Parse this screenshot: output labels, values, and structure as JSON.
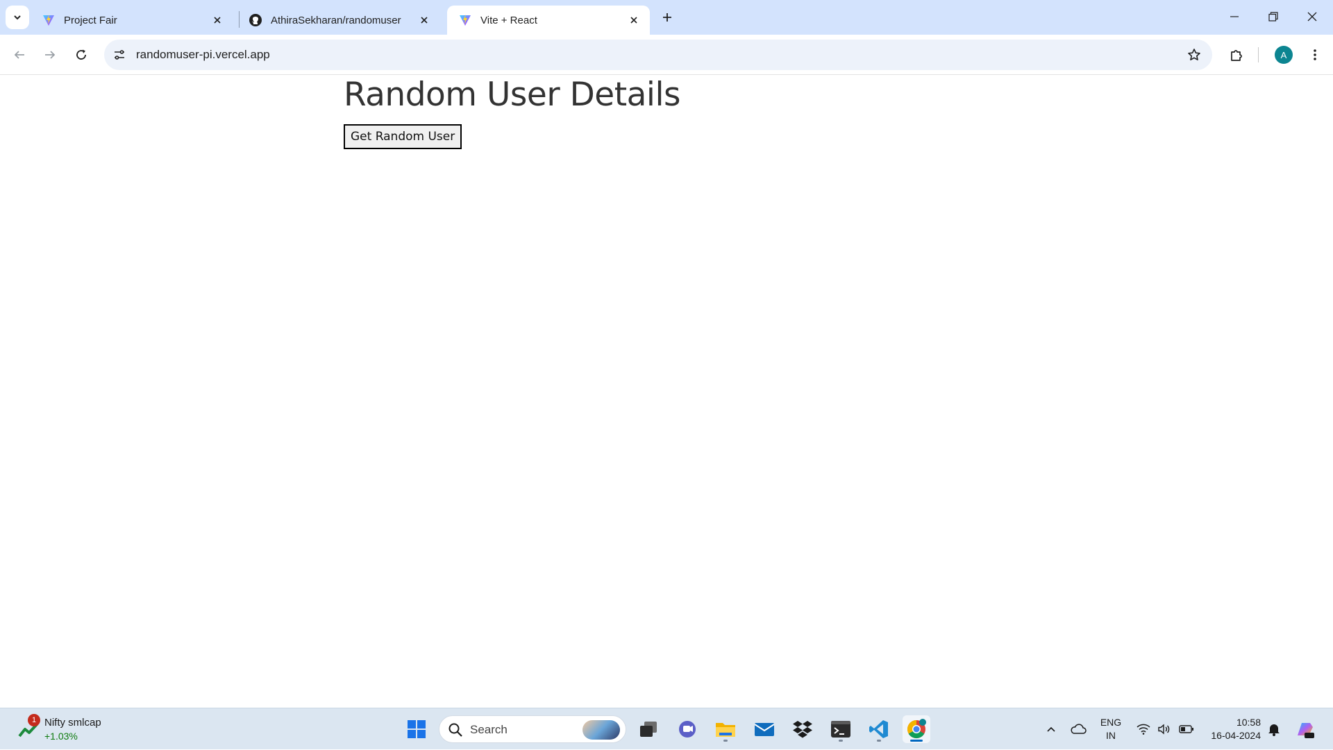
{
  "browser": {
    "tabs": [
      {
        "title": "Project Fair",
        "icon": "vite-icon",
        "active": false
      },
      {
        "title": "AthiraSekharan/randomuser",
        "icon": "github-icon",
        "active": false
      },
      {
        "title": "Vite + React",
        "icon": "vite-icon",
        "active": true
      }
    ],
    "url": "randomuser-pi.vercel.app",
    "profile_initial": "A"
  },
  "page": {
    "title": "Random User Details",
    "button_label": "Get Random User"
  },
  "taskbar": {
    "widget": {
      "name": "Nifty smlcap",
      "value": "+1.03%",
      "badge": "1"
    },
    "search_placeholder": "Search",
    "language": {
      "line1": "ENG",
      "line2": "IN"
    },
    "clock": {
      "time": "10:58",
      "date": "16-04-2024"
    }
  },
  "colors": {
    "tabstrip_bg": "#d3e3fd",
    "omnibox_bg": "#edf2fa",
    "profile_bg": "#0c8591",
    "taskbar_bg": "#dbe6f1",
    "widget_positive": "#0f7b0f"
  }
}
